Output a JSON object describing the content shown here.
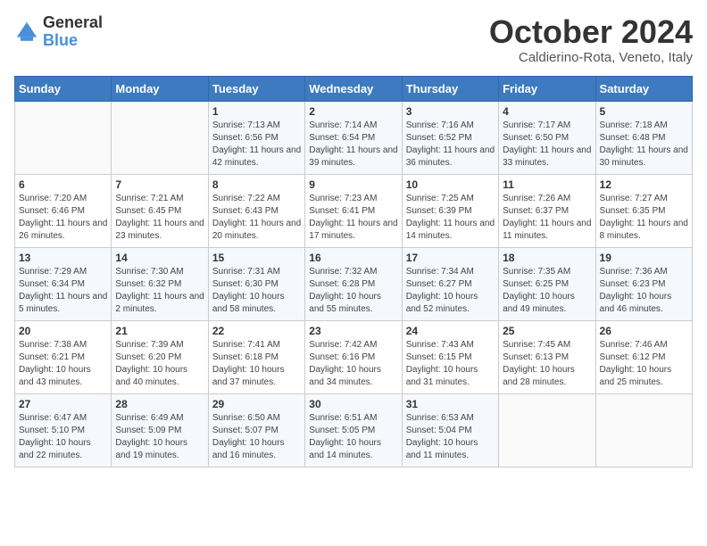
{
  "header": {
    "logo_line1": "General",
    "logo_line2": "Blue",
    "month_title": "October 2024",
    "location": "Caldierino-Rota, Veneto, Italy"
  },
  "days_of_week": [
    "Sunday",
    "Monday",
    "Tuesday",
    "Wednesday",
    "Thursday",
    "Friday",
    "Saturday"
  ],
  "weeks": [
    [
      {
        "day": "",
        "info": ""
      },
      {
        "day": "",
        "info": ""
      },
      {
        "day": "1",
        "info": "Sunrise: 7:13 AM\nSunset: 6:56 PM\nDaylight: 11 hours and 42 minutes."
      },
      {
        "day": "2",
        "info": "Sunrise: 7:14 AM\nSunset: 6:54 PM\nDaylight: 11 hours and 39 minutes."
      },
      {
        "day": "3",
        "info": "Sunrise: 7:16 AM\nSunset: 6:52 PM\nDaylight: 11 hours and 36 minutes."
      },
      {
        "day": "4",
        "info": "Sunrise: 7:17 AM\nSunset: 6:50 PM\nDaylight: 11 hours and 33 minutes."
      },
      {
        "day": "5",
        "info": "Sunrise: 7:18 AM\nSunset: 6:48 PM\nDaylight: 11 hours and 30 minutes."
      }
    ],
    [
      {
        "day": "6",
        "info": "Sunrise: 7:20 AM\nSunset: 6:46 PM\nDaylight: 11 hours and 26 minutes."
      },
      {
        "day": "7",
        "info": "Sunrise: 7:21 AM\nSunset: 6:45 PM\nDaylight: 11 hours and 23 minutes."
      },
      {
        "day": "8",
        "info": "Sunrise: 7:22 AM\nSunset: 6:43 PM\nDaylight: 11 hours and 20 minutes."
      },
      {
        "day": "9",
        "info": "Sunrise: 7:23 AM\nSunset: 6:41 PM\nDaylight: 11 hours and 17 minutes."
      },
      {
        "day": "10",
        "info": "Sunrise: 7:25 AM\nSunset: 6:39 PM\nDaylight: 11 hours and 14 minutes."
      },
      {
        "day": "11",
        "info": "Sunrise: 7:26 AM\nSunset: 6:37 PM\nDaylight: 11 hours and 11 minutes."
      },
      {
        "day": "12",
        "info": "Sunrise: 7:27 AM\nSunset: 6:35 PM\nDaylight: 11 hours and 8 minutes."
      }
    ],
    [
      {
        "day": "13",
        "info": "Sunrise: 7:29 AM\nSunset: 6:34 PM\nDaylight: 11 hours and 5 minutes."
      },
      {
        "day": "14",
        "info": "Sunrise: 7:30 AM\nSunset: 6:32 PM\nDaylight: 11 hours and 2 minutes."
      },
      {
        "day": "15",
        "info": "Sunrise: 7:31 AM\nSunset: 6:30 PM\nDaylight: 10 hours and 58 minutes."
      },
      {
        "day": "16",
        "info": "Sunrise: 7:32 AM\nSunset: 6:28 PM\nDaylight: 10 hours and 55 minutes."
      },
      {
        "day": "17",
        "info": "Sunrise: 7:34 AM\nSunset: 6:27 PM\nDaylight: 10 hours and 52 minutes."
      },
      {
        "day": "18",
        "info": "Sunrise: 7:35 AM\nSunset: 6:25 PM\nDaylight: 10 hours and 49 minutes."
      },
      {
        "day": "19",
        "info": "Sunrise: 7:36 AM\nSunset: 6:23 PM\nDaylight: 10 hours and 46 minutes."
      }
    ],
    [
      {
        "day": "20",
        "info": "Sunrise: 7:38 AM\nSunset: 6:21 PM\nDaylight: 10 hours and 43 minutes."
      },
      {
        "day": "21",
        "info": "Sunrise: 7:39 AM\nSunset: 6:20 PM\nDaylight: 10 hours and 40 minutes."
      },
      {
        "day": "22",
        "info": "Sunrise: 7:41 AM\nSunset: 6:18 PM\nDaylight: 10 hours and 37 minutes."
      },
      {
        "day": "23",
        "info": "Sunrise: 7:42 AM\nSunset: 6:16 PM\nDaylight: 10 hours and 34 minutes."
      },
      {
        "day": "24",
        "info": "Sunrise: 7:43 AM\nSunset: 6:15 PM\nDaylight: 10 hours and 31 minutes."
      },
      {
        "day": "25",
        "info": "Sunrise: 7:45 AM\nSunset: 6:13 PM\nDaylight: 10 hours and 28 minutes."
      },
      {
        "day": "26",
        "info": "Sunrise: 7:46 AM\nSunset: 6:12 PM\nDaylight: 10 hours and 25 minutes."
      }
    ],
    [
      {
        "day": "27",
        "info": "Sunrise: 6:47 AM\nSunset: 5:10 PM\nDaylight: 10 hours and 22 minutes."
      },
      {
        "day": "28",
        "info": "Sunrise: 6:49 AM\nSunset: 5:09 PM\nDaylight: 10 hours and 19 minutes."
      },
      {
        "day": "29",
        "info": "Sunrise: 6:50 AM\nSunset: 5:07 PM\nDaylight: 10 hours and 16 minutes."
      },
      {
        "day": "30",
        "info": "Sunrise: 6:51 AM\nSunset: 5:05 PM\nDaylight: 10 hours and 14 minutes."
      },
      {
        "day": "31",
        "info": "Sunrise: 6:53 AM\nSunset: 5:04 PM\nDaylight: 10 hours and 11 minutes."
      },
      {
        "day": "",
        "info": ""
      },
      {
        "day": "",
        "info": ""
      }
    ]
  ]
}
